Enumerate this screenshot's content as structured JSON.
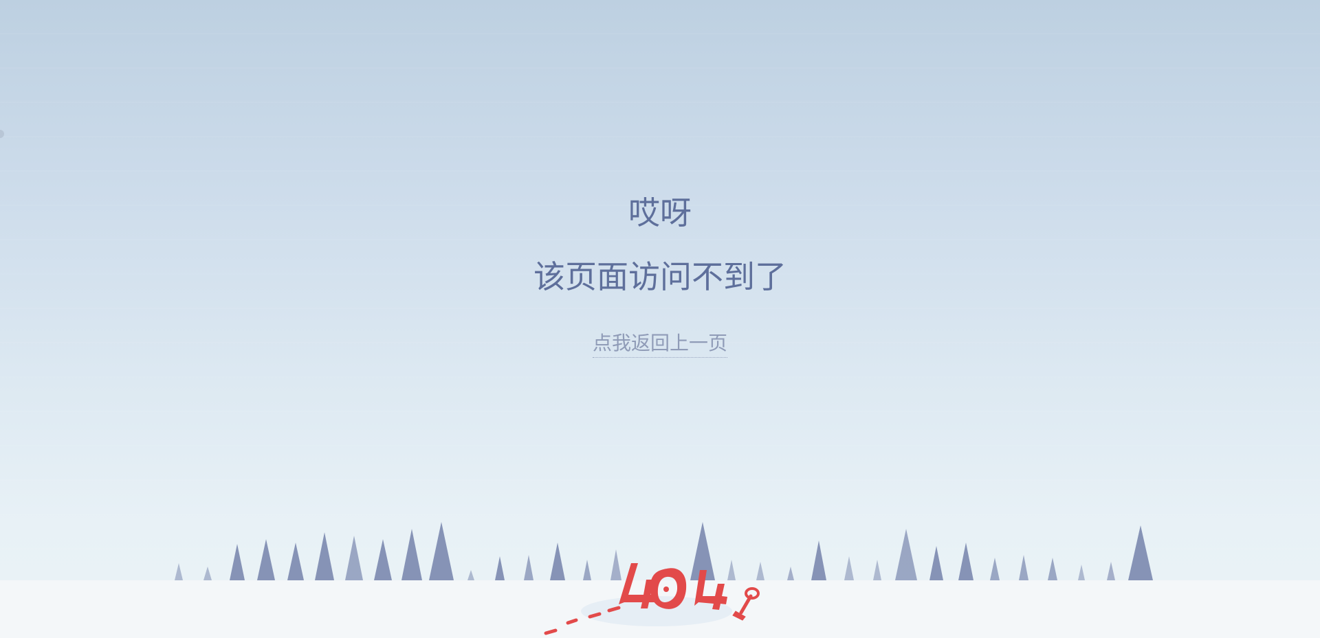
{
  "page": {
    "heading_line_1": "哎呀",
    "heading_line_2": "该页面访问不到了",
    "back_link_label": "点我返回上一页"
  },
  "illustration": {
    "error_code": "404",
    "icon": "shovel-icon"
  },
  "colors": {
    "heading": "#5e6f9b",
    "link": "#8f9bb7",
    "tree": "#8693b6",
    "accent_red": "#e24a4a",
    "ground": "#f4f7f9"
  }
}
